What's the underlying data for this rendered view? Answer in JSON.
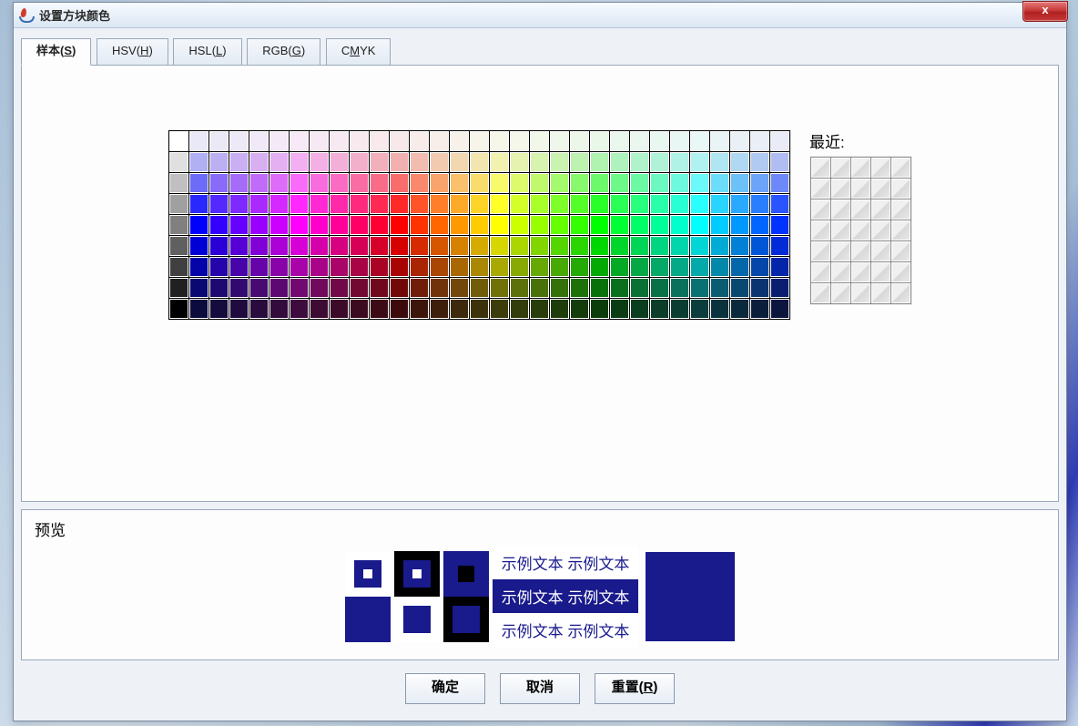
{
  "window": {
    "title": "设置方块颜色"
  },
  "tabs": [
    {
      "pre": "样本(",
      "u": "S",
      "post": ")"
    },
    {
      "pre": "HSV(",
      "u": "H",
      "post": ")"
    },
    {
      "pre": "HSL(",
      "u": "L",
      "post": ")"
    },
    {
      "pre": "RGB(",
      "u": "G",
      "post": ")"
    },
    {
      "pre": "C",
      "u": "M",
      "post": "YK"
    }
  ],
  "active_tab": 0,
  "recent_label": "最近:",
  "preview_label": "预览",
  "sample_text": "示例文本",
  "selected_color": "#191a8c",
  "buttons": {
    "ok": "确定",
    "cancel": "取消",
    "reset_pre": "重置(",
    "reset_u": "R",
    "reset_post": ")"
  },
  "close_label": "x",
  "swatches": {
    "cols": 31,
    "rows": 9,
    "gray_col": [
      "#ffffff",
      "#e0e0e0",
      "#c0c0c0",
      "#a0a0a0",
      "#808080",
      "#606060",
      "#404040",
      "#202020",
      "#000000"
    ],
    "hue_count": 30
  }
}
